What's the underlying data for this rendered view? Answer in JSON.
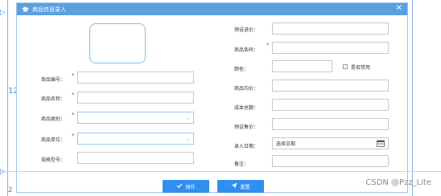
{
  "dialog": {
    "title": "商品信息录入",
    "close_glyph": "✕"
  },
  "guides": {
    "side_mark": "12",
    "bottom_mark": "2"
  },
  "form": {
    "left": [
      {
        "label": "商品编号：",
        "required": true,
        "value": "",
        "type": "text"
      },
      {
        "label": "商品名称：",
        "required": true,
        "value": "",
        "type": "text"
      },
      {
        "label": "商品类别：",
        "required": true,
        "value": "",
        "type": "select"
      },
      {
        "label": "商品单位：",
        "required": true,
        "value": "",
        "type": "select"
      },
      {
        "label": "规格型号：",
        "required": false,
        "value": "",
        "type": "text"
      }
    ],
    "right": {
      "purchase_price_label": "预设进价：",
      "barcode_label": "商品条码：",
      "color_label": "颜色：",
      "disabled_label": "是否禁用",
      "avg_price_label": "商品均价：",
      "total_cost_label": "成本总额：",
      "sale_price_label": "预设售价：",
      "stock_date_label": "录入日期：",
      "stock_date_value": "选择日期",
      "note_label": "备注："
    }
  },
  "buttons": {
    "save": "保存",
    "reset": "重置"
  },
  "watermark": "CSDN @Pzz_Lite",
  "colors": {
    "titlebar": "#5a9fe0",
    "button": "#2f8ef0",
    "required": "#ee2233",
    "photo_border": "#7fc1e8"
  }
}
